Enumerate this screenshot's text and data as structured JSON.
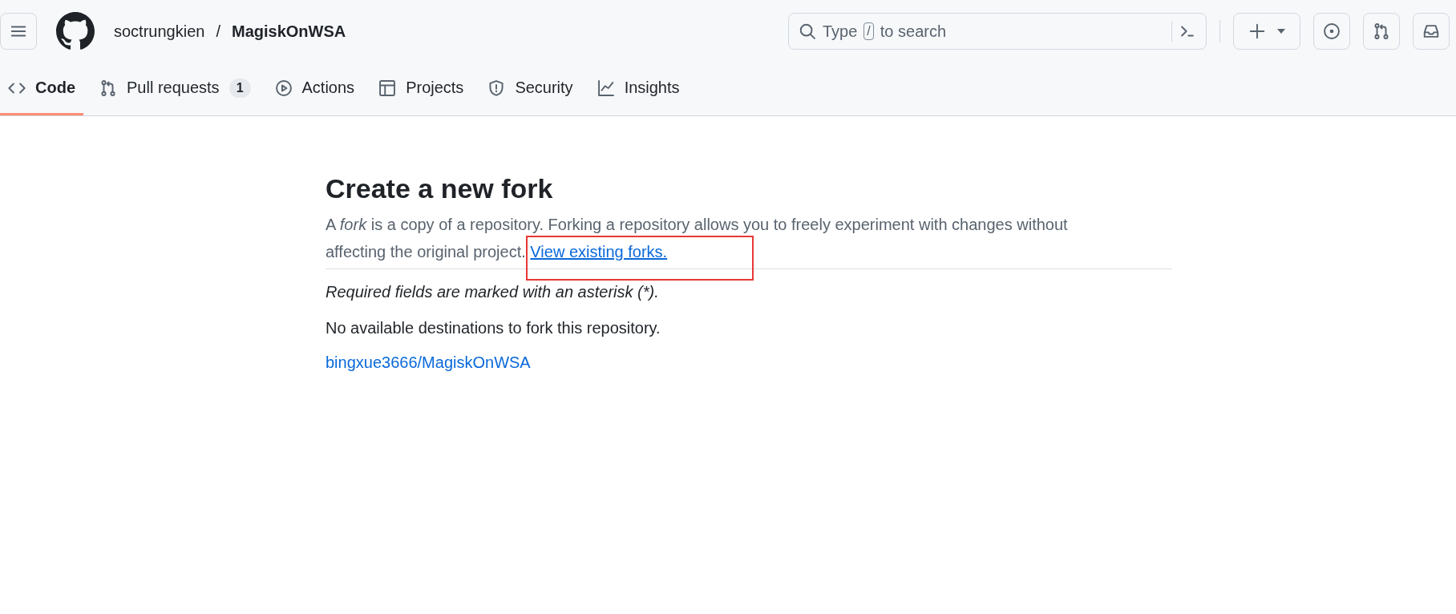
{
  "header": {
    "owner": "soctrungkien",
    "separator": "/",
    "repo": "MagiskOnWSA",
    "search": {
      "placeholder_before": "Type",
      "key": "/",
      "placeholder_after": "to search"
    }
  },
  "tabs": [
    {
      "label": "Code",
      "selected": true
    },
    {
      "label": "Pull requests",
      "count": "1",
      "selected": false
    },
    {
      "label": "Actions",
      "selected": false
    },
    {
      "label": "Projects",
      "selected": false
    },
    {
      "label": "Security",
      "selected": false
    },
    {
      "label": "Insights",
      "selected": false
    }
  ],
  "main": {
    "title": "Create a new fork",
    "description": "A *fork* is a copy of a repository. Forking a repository allows you to freely experiment with changes without affecting the original project.",
    "description_link": "View existing forks.",
    "required_note": "Required fields are marked with an asterisk (*).",
    "message": "No available destinations to fork this repository.",
    "repo_link": "bingxue3666/MagiskOnWSA"
  }
}
